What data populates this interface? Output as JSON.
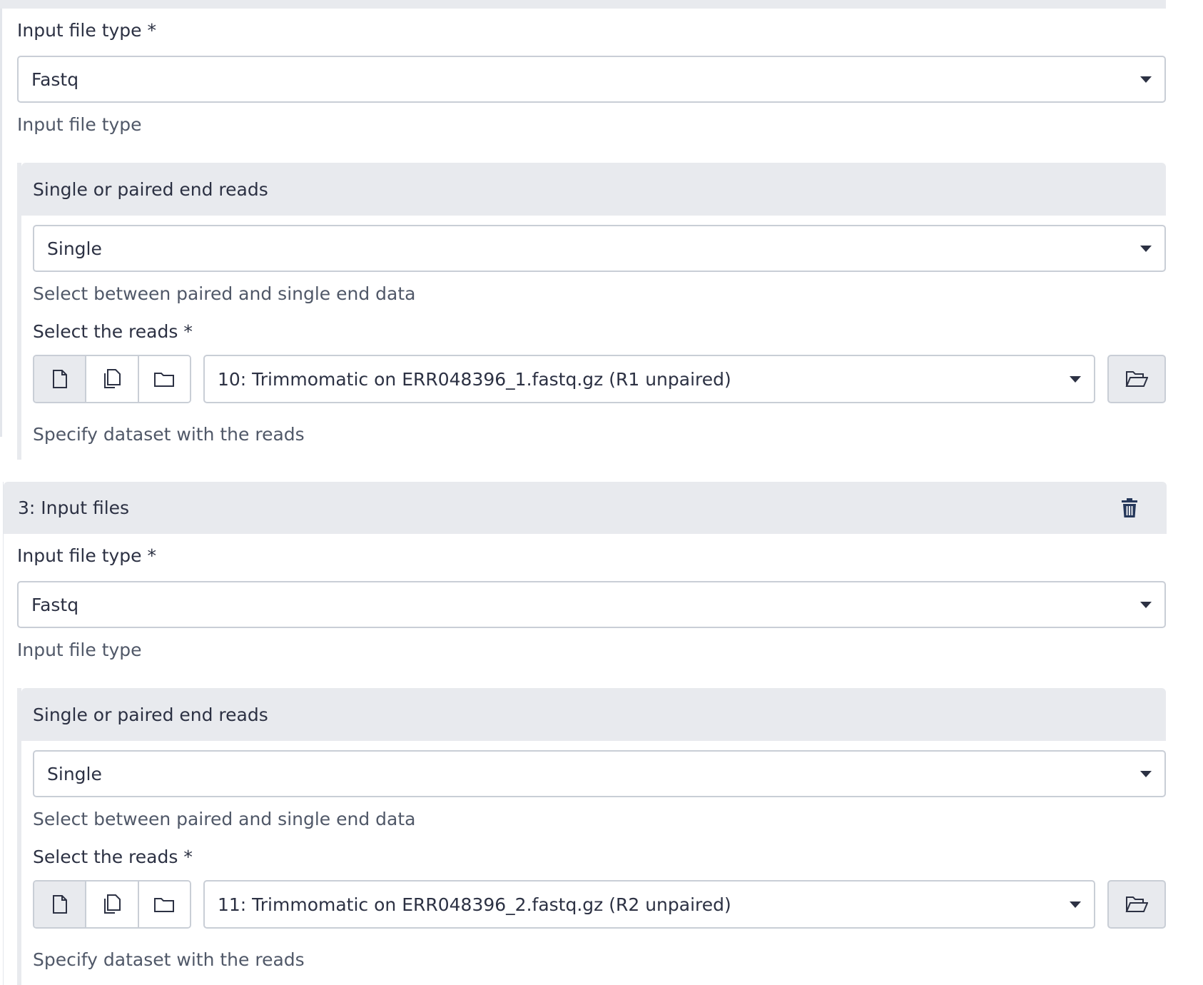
{
  "block2": {
    "file_type": {
      "label": "Input file type",
      "required_mark": "*",
      "value": "Fastq",
      "help": "Input file type"
    },
    "reads_section": {
      "title": "Single or paired end reads",
      "mode_value": "Single",
      "mode_help": "Select between paired and single end data",
      "reads_label": "Select the reads",
      "required_mark": "*",
      "dataset_value": "10: Trimmomatic on ERR048396_1.fastq.gz (R1 unpaired)",
      "dataset_help": "Specify dataset with the reads"
    }
  },
  "block3": {
    "title": "3: Input files",
    "file_type": {
      "label": "Input file type",
      "required_mark": "*",
      "value": "Fastq",
      "help": "Input file type"
    },
    "reads_section": {
      "title": "Single or paired end reads",
      "mode_value": "Single",
      "mode_help": "Select between paired and single end data",
      "reads_label": "Select the reads",
      "required_mark": "*",
      "dataset_value": "11: Trimmomatic on ERR048396_2.fastq.gz (R2 unpaired)",
      "dataset_help": "Specify dataset with the reads"
    }
  },
  "icons": {
    "single_dataset": "file-icon",
    "multiple_datasets": "files-icon",
    "collection": "folder-icon",
    "browse": "folder-open-icon",
    "delete": "trash-icon"
  },
  "colors": {
    "header_bg": "#e8eaee",
    "border": "#c9ced6",
    "text": "#2c3143",
    "accent_icon": "#25375a"
  }
}
